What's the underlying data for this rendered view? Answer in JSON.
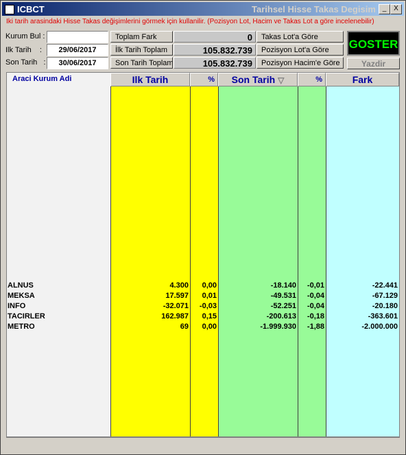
{
  "window": {
    "app_name": "ICBCT",
    "title": "Tarihsel Hisse Takas Degisim",
    "minimize": "_",
    "maximize": "□",
    "close": "X"
  },
  "info_text": "Iki tarih arasindaki Hisse Takas değişimlerini görmek için kullanilir. (Pozisyon Lot, Hacim ve Takas Lot a göre incelenebilir)",
  "form": {
    "kurum_bul_label": "Kurum Bul :",
    "kurum_bul_value": "",
    "ilk_tarih_label": "Ilk Tarih    :",
    "ilk_tarih_value": "29/06/2017",
    "son_tarih_label": "Son Tarih   :",
    "son_tarih_value": "30/06/2017"
  },
  "totals": {
    "toplam_fark_label": "Toplam Fark",
    "toplam_fark_value": "0",
    "ilk_tarih_toplam_label": "İlk Tarih Toplam",
    "ilk_tarih_toplam_value": "105.832.739",
    "son_tarih_toplam_label": "Son Tarih Toplam",
    "son_tarih_toplam_value": "105.832.739"
  },
  "options": {
    "takas_lot": "Takas Lot'a Göre",
    "pozisyon_lot": "Pozisyon Lot'a Göre",
    "pozisyon_hacim": "Pozisyon Hacim'e Göre"
  },
  "buttons": {
    "goster": "GOSTER",
    "yazdir": "Yazdir"
  },
  "grid": {
    "headers": {
      "name": "Araci Kurum Adi",
      "ilk": "Ilk Tarih",
      "ilk_pct": "%",
      "son": "Son Tarih",
      "son_sort": "▽",
      "son_pct": "%",
      "fark": "Fark"
    },
    "colors": {
      "ilk": "#ffff00",
      "son": "#98fb98",
      "fark": "#c0ffff"
    },
    "rows": [
      {
        "name": "ALNUS",
        "ilk": "4.300",
        "ilk_pct": "0,00",
        "son": "-18.140",
        "son_pct": "-0,01",
        "fark": "-22.441"
      },
      {
        "name": "MEKSA",
        "ilk": "17.597",
        "ilk_pct": "0,01",
        "son": "-49.531",
        "son_pct": "-0,04",
        "fark": "-67.129"
      },
      {
        "name": "INFO",
        "ilk": "-32.071",
        "ilk_pct": "-0,03",
        "son": "-52.251",
        "son_pct": "-0,04",
        "fark": "-20.180"
      },
      {
        "name": "TACIRLER",
        "ilk": "162.987",
        "ilk_pct": "0,15",
        "son": "-200.613",
        "son_pct": "-0,18",
        "fark": "-363.601"
      },
      {
        "name": "METRO",
        "ilk": "69",
        "ilk_pct": "0,00",
        "son": "-1.999.930",
        "son_pct": "-1,88",
        "fark": "-2.000.000"
      }
    ]
  }
}
